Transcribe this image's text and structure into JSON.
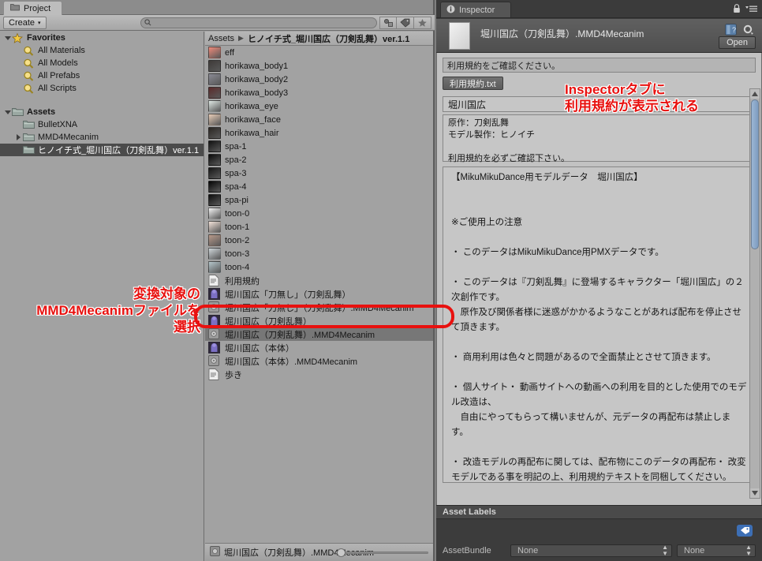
{
  "project": {
    "tab_label": "Project",
    "folder_icon": "folder-icon",
    "toolbar": {
      "create_label": "Create",
      "create_arrow": "▾",
      "search_placeholder": "",
      "search_value": "",
      "icons": [
        {
          "name": "search-by-type-icon",
          "glyph": "◆"
        },
        {
          "name": "search-by-label-icon",
          "glyph": "◆"
        },
        {
          "name": "favorite-star-icon",
          "glyph": "★"
        }
      ]
    },
    "tree": [
      {
        "label": "Favorites",
        "depth": 0,
        "twisty": "down",
        "icon": "star-icon",
        "bold": true,
        "selected": false
      },
      {
        "label": "All Materials",
        "depth": 1,
        "twisty": "",
        "icon": "search-icon",
        "bold": false,
        "selected": false
      },
      {
        "label": "All Models",
        "depth": 1,
        "twisty": "",
        "icon": "search-icon",
        "bold": false,
        "selected": false
      },
      {
        "label": "All Prefabs",
        "depth": 1,
        "twisty": "",
        "icon": "search-icon",
        "bold": false,
        "selected": false
      },
      {
        "label": "All Scripts",
        "depth": 1,
        "twisty": "",
        "icon": "search-icon",
        "bold": false,
        "selected": false
      },
      {
        "label": "",
        "depth": 0,
        "twisty": "",
        "icon": "",
        "bold": false,
        "selected": false,
        "spacer": true
      },
      {
        "label": "Assets",
        "depth": 0,
        "twisty": "down",
        "icon": "folder-icon",
        "bold": true,
        "selected": false
      },
      {
        "label": "BulletXNA",
        "depth": 1,
        "twisty": "",
        "icon": "folder-icon",
        "bold": false,
        "selected": false
      },
      {
        "label": "MMD4Mecanim",
        "depth": 1,
        "twisty": "right",
        "icon": "folder-icon",
        "bold": false,
        "selected": false
      },
      {
        "label": "ヒノイチ式_堀川国広（刀剣乱舞）ver.1.1",
        "depth": 1,
        "twisty": "",
        "icon": "folder-icon",
        "bold": false,
        "selected": true
      }
    ],
    "breadcrumb": {
      "root": "Assets",
      "separator": "▶",
      "current": "ヒノイチ式_堀川国広（刀剣乱舞）ver.1.1"
    },
    "files": [
      {
        "label": "eff",
        "icon": "texture-thumb",
        "color": "#f08a7a",
        "selected": false
      },
      {
        "label": "horikawa_body1",
        "icon": "texture-thumb",
        "color": "#3e3a38",
        "selected": false
      },
      {
        "label": "horikawa_body2",
        "icon": "texture-thumb",
        "color": "#8a8a94",
        "selected": false
      },
      {
        "label": "horikawa_body3",
        "icon": "texture-thumb",
        "color": "#5a2a2a",
        "selected": false
      },
      {
        "label": "horikawa_eye",
        "icon": "texture-thumb",
        "color": "#dfe8e4",
        "selected": false
      },
      {
        "label": "horikawa_face",
        "icon": "texture-thumb",
        "color": "#e8cdb8",
        "selected": false
      },
      {
        "label": "horikawa_hair",
        "icon": "texture-thumb",
        "color": "#2a2622",
        "selected": false
      },
      {
        "label": "spa-1",
        "icon": "texture-thumb",
        "color": "#121212",
        "selected": false
      },
      {
        "label": "spa-2",
        "icon": "texture-thumb",
        "color": "#0a0a0a",
        "selected": false
      },
      {
        "label": "spa-3",
        "icon": "texture-thumb",
        "color": "#161616",
        "selected": false
      },
      {
        "label": "spa-4",
        "icon": "texture-thumb",
        "color": "#050505",
        "selected": false
      },
      {
        "label": "spa-pi",
        "icon": "texture-thumb",
        "color": "#0d0d0d",
        "selected": false
      },
      {
        "label": "toon-0",
        "icon": "texture-thumb",
        "color": "#f4f4f4",
        "selected": false
      },
      {
        "label": "toon-1",
        "icon": "texture-thumb",
        "color": "#f3e3da",
        "selected": false
      },
      {
        "label": "toon-2",
        "icon": "texture-thumb",
        "color": "#b99a8b",
        "selected": false
      },
      {
        "label": "toon-3",
        "icon": "texture-thumb",
        "color": "#cfd6da",
        "selected": false
      },
      {
        "label": "toon-4",
        "icon": "texture-thumb",
        "color": "#b6c7cc",
        "selected": false
      },
      {
        "label": "利用規約",
        "icon": "text-file-icon",
        "color": "#e8e8e8",
        "selected": false
      },
      {
        "label": "堀川国広「刀無し」（刀剣乱舞）",
        "icon": "prefab-icon",
        "color": "#7a6fc0",
        "selected": false
      },
      {
        "label": "堀川国広「刀無し」（刀剣乱舞）.MMD4Mecanim",
        "icon": "scriptable-object-icon",
        "color": "#9a9a9a",
        "selected": false
      },
      {
        "label": "堀川国広（刀剣乱舞）",
        "icon": "prefab-icon",
        "color": "#7a6fc0",
        "selected": false
      },
      {
        "label": "堀川国広（刀剣乱舞）.MMD4Mecanim",
        "icon": "scriptable-object-icon",
        "color": "#9a9a9a",
        "selected": true
      },
      {
        "label": "堀川国広（本体）",
        "icon": "prefab-icon",
        "color": "#7a6fc0",
        "selected": false
      },
      {
        "label": "堀川国広（本体）.MMD4Mecanim",
        "icon": "scriptable-object-icon",
        "color": "#9a9a9a",
        "selected": false
      },
      {
        "label": "歩き",
        "icon": "text-file-icon",
        "color": "#f0f0f0",
        "selected": false
      }
    ],
    "status_bar": {
      "icon": "scriptable-object-icon",
      "label": "堀川国広（刀剣乱舞）.MMD4Mecanim",
      "zoom_value": "0"
    }
  },
  "inspector": {
    "tab_label": "Inspector",
    "tab_icon": "info-icon",
    "tab_icons": [
      {
        "name": "lock-icon",
        "glyph": "🔒"
      },
      {
        "name": "menu-icon",
        "glyph": "≡"
      }
    ],
    "asset_title": "堀川国広（刀剣乱舞）.MMD4Mecanim",
    "head_icons": [
      {
        "name": "help-icon",
        "glyph": "?"
      },
      {
        "name": "gear-icon",
        "glyph": "⚙"
      }
    ],
    "open_label": "Open",
    "notice": "利用規約をご確認ください。",
    "txt_button_label": "利用規約.txt",
    "model_name": "堀川国広",
    "model_desc": "原作：刀剣乱舞\nモデル製作：ヒノイチ\n\n利用規約を必ずご確認下さい。",
    "license_text": "【MikuMikuDance用モデルデータ　堀川国広】\n\n\n※ご使用上の注意\n\n・ このデータはMikuMikuDance用PMXデータです。\n\n・ このデータは『刀剣乱舞』に登場するキャラクター「堀川国広」の２次創作です。\n　原作及び関係者様に迷惑がかかるようなことがあれば配布を停止させて頂きます。\n\n・ 商用利用は色々と問題があるので全面禁止とさせて頂きます。\n\n・ 個人サイト・ 動画サイトへの動画への利用を目的とした使用でのモデル改造は、\n　自由にやってもらって構いませんが、元データの再配布は禁止します。\n\n・ 改造モデルの再配布に関しては、配布物にこのデータの再配布・ 改変モデルである事を明記の上、利用規約テキストを同梱してください。",
    "asset_labels": {
      "title": "Asset Labels",
      "tag_icon": "label-tag-icon",
      "assetbundle_label": "AssetBundle",
      "assetbundle_value": "None",
      "variant_value": "None"
    }
  },
  "annotations": {
    "left": "変換対象の\nMMD4Mecanimファイルを\n選択",
    "right": "Inspectorタブに\n利用規約が表示される",
    "color": "#e8110f"
  }
}
